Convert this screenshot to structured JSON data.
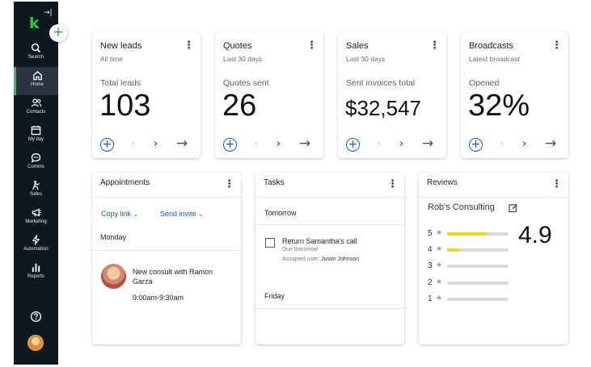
{
  "sidebar": {
    "logo": "k",
    "items": [
      {
        "label": "Search",
        "icon": "search-icon"
      },
      {
        "label": "Home",
        "icon": "home-icon",
        "active": true
      },
      {
        "label": "Contacts",
        "icon": "contacts-icon"
      },
      {
        "label": "My day",
        "icon": "calendar-icon"
      },
      {
        "label": "Comms",
        "icon": "chat-icon"
      },
      {
        "label": "Sales",
        "icon": "sales-icon"
      },
      {
        "label": "Marketing",
        "icon": "megaphone-icon"
      },
      {
        "label": "Automation",
        "icon": "bolt-icon"
      },
      {
        "label": "Reports",
        "icon": "bar-chart-icon"
      }
    ],
    "accent_color": "#2ec34a"
  },
  "kpis": [
    {
      "title": "New leads",
      "subtitle": "All time",
      "metric_label": "Total leads",
      "value": "103"
    },
    {
      "title": "Quotes",
      "subtitle": "Last 30 days",
      "metric_label": "Quotes sent",
      "value": "26"
    },
    {
      "title": "Sales",
      "subtitle": "Last 30 days",
      "metric_label": "Sent invoices total",
      "value": "$32,547"
    },
    {
      "title": "Broadcasts",
      "subtitle": "Latest broadcast",
      "metric_label": "Opened",
      "value": "32%"
    }
  ],
  "appointments": {
    "title": "Appointments",
    "copy_link": "Copy link",
    "send_invite": "Send invite",
    "day": "Monday",
    "event_title": "New consult with Ramon Garza",
    "event_time": "9:00am-9:30am"
  },
  "tasks": {
    "title": "Tasks",
    "group_1": "Tomorrow",
    "task_title": "Return Samantha's call",
    "task_due": "Due tomorrow",
    "task_assigned_label": "Assigned user:",
    "task_assigned_user": "Justin Johnson",
    "group_2": "Friday"
  },
  "reviews": {
    "title": "Reviews",
    "business": "Rob's Consulting",
    "average": "4.9",
    "rows": [
      {
        "stars": "5",
        "fraction": 0.65
      },
      {
        "stars": "4",
        "fraction": 0.2
      },
      {
        "stars": "3",
        "fraction": 0
      },
      {
        "stars": "2",
        "fraction": 0
      },
      {
        "stars": "1",
        "fraction": 0
      }
    ],
    "bar_color": "#f2d32b"
  },
  "colors": {
    "link": "#1a56c7",
    "sidebar_bg": "#10181f"
  }
}
